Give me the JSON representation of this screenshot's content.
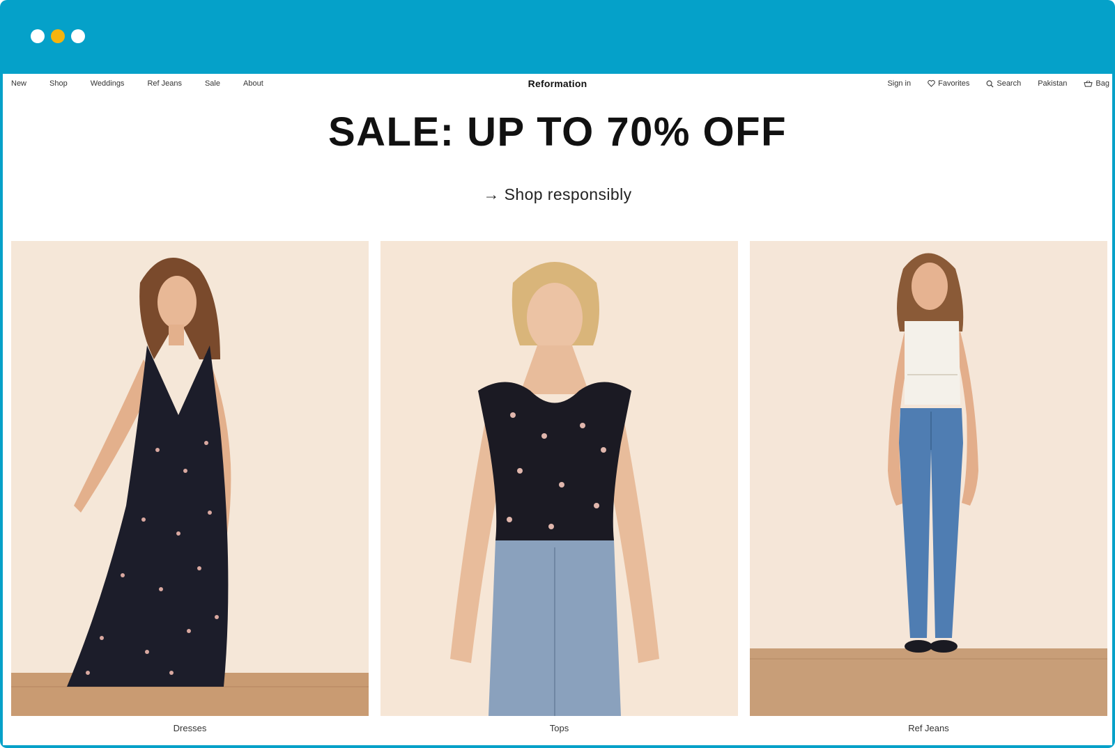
{
  "window": {
    "dot_colors": [
      "#ffffff",
      "#f6b40e",
      "#ffffff"
    ],
    "frame_color": "#05a1c9"
  },
  "nav": {
    "left_items": [
      "New",
      "Shop",
      "Weddings",
      "Ref Jeans",
      "Sale",
      "About"
    ],
    "brand": "Reformation",
    "sign_in": "Sign in",
    "favorites": "Favorites",
    "search": "Search",
    "country": "Pakistan",
    "bag": "Bag"
  },
  "hero": {
    "headline": "SALE: UP TO 70% OFF",
    "cta": "→ Shop responsibly"
  },
  "categories": [
    {
      "label": "Dresses",
      "image": "model-floral-midi-dress"
    },
    {
      "label": "Tops",
      "image": "model-floral-puff-sleeve-top"
    },
    {
      "label": "Ref Jeans",
      "image": "model-white-cami-straight-jeans"
    }
  ]
}
